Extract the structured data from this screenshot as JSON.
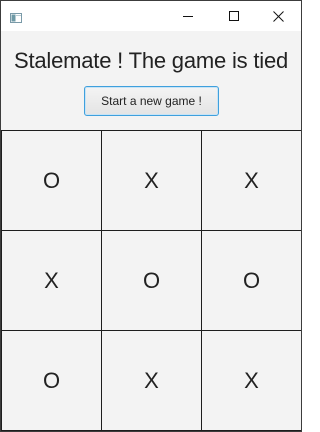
{
  "window": {
    "icon": "java-app-icon",
    "controls": {
      "minimize": "minimize-icon",
      "maximize": "maximize-icon",
      "close": "close-icon"
    }
  },
  "status_text": "Stalemate ! The game is tied",
  "new_game_button_label": "Start a new game !",
  "board": {
    "cells": [
      "O",
      "X",
      "X",
      "X",
      "O",
      "O",
      "O",
      "X",
      "X"
    ]
  },
  "colors": {
    "background": "#f3f3f3",
    "grid_line": "#1e1e1e",
    "button_focus": "#3fa0dd",
    "text": "#222222"
  }
}
